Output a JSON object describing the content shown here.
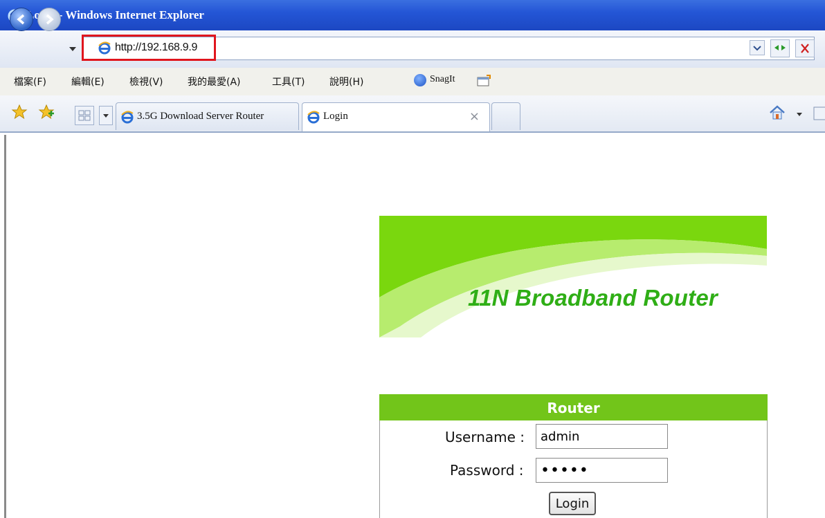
{
  "window": {
    "title": "Login - Windows Internet Explorer"
  },
  "address_bar": {
    "url": "http://192.168.9.9"
  },
  "menu": {
    "items": [
      "檔案(F)",
      "編輯(E)",
      "檢視(V)",
      "我的最愛(A)",
      "工具(T)",
      "說明(H)"
    ],
    "snagit_label": "SnagIt"
  },
  "tabs": [
    {
      "label": "3.5G Download Server Router"
    },
    {
      "label": "Login",
      "close": "×"
    }
  ],
  "page": {
    "banner_title": "11N Broadband Router",
    "login_header": "Router",
    "username_label": "Username :",
    "username_value": "admin",
    "password_label": "Password :",
    "password_value": "admin",
    "login_button": "Login"
  },
  "colors": {
    "accent_green": "#72c51a",
    "banner_text": "#2fae16",
    "highlight_red": "#e0151d",
    "titlebar_blue": "#2456d6"
  },
  "icons": [
    "ie-logo-icon",
    "back-icon",
    "forward-icon",
    "refresh-icon",
    "stop-icon",
    "favorites-star-icon",
    "add-favorites-icon",
    "quick-tabs-icon",
    "home-icon",
    "snagit-icon"
  ]
}
